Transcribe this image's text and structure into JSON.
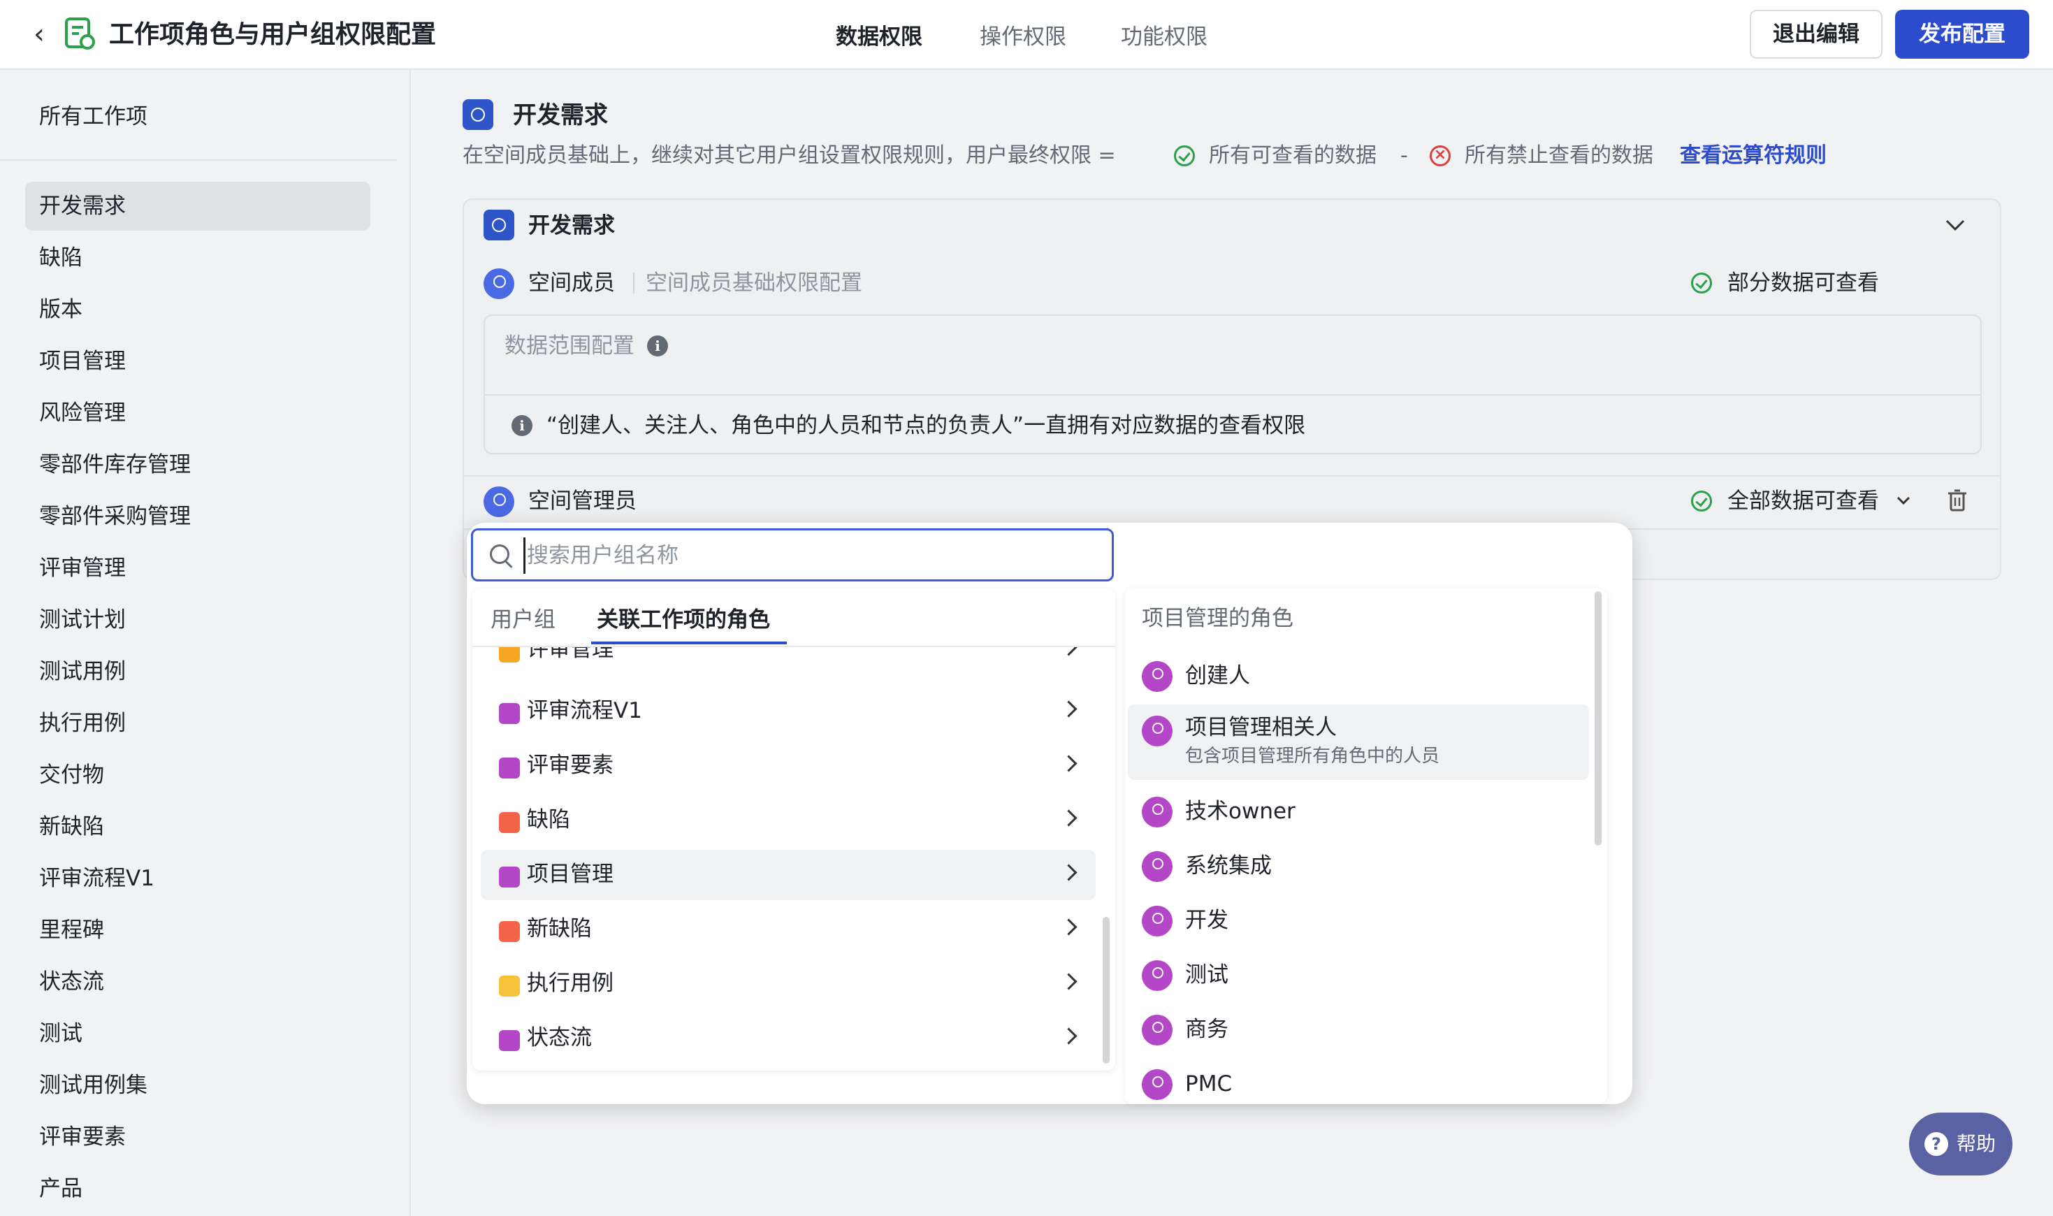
{
  "header": {
    "back_glyph": "‹",
    "title": "工作项角色与用户组权限配置",
    "tabs": [
      {
        "label": "数据权限",
        "active": true
      },
      {
        "label": "操作权限",
        "active": false
      },
      {
        "label": "功能权限",
        "active": false
      }
    ],
    "exit_label": "退出编辑",
    "publish_label": "发布配置"
  },
  "sidebar": {
    "all_label": "所有工作项",
    "items": [
      "开发需求",
      "缺陷",
      "版本",
      "项目管理",
      "风险管理",
      "零部件库存管理",
      "零部件采购管理",
      "评审管理",
      "测试计划",
      "测试用例",
      "执行用例",
      "交付物",
      "新缺陷",
      "评审流程V1",
      "里程碑",
      "状态流",
      "测试",
      "测试用例集",
      "评审要素",
      "产品"
    ],
    "active_index": 0
  },
  "main": {
    "section_title": "开发需求",
    "desc_prefix": "在空间成员基础上，继续对其它用户组设置权限规则，用户最终权限 =",
    "desc_allowed": "所有可查看的数据",
    "desc_minus": "-",
    "desc_forbidden": "所有禁止查看的数据",
    "desc_link": "查看运算符规则",
    "card": {
      "title": "开发需求",
      "member": {
        "name": "空间成员",
        "subtitle": "空间成员基础权限配置",
        "status": "部分数据可查看"
      },
      "scope_label": "数据范围配置",
      "note": "“创建人、关注人、角色中的人员和节点的负责人”一直拥有对应数据的查看权限",
      "admin": {
        "name": "空间管理员",
        "status": "全部数据可查看"
      }
    }
  },
  "popup": {
    "search_placeholder": "搜索用户组名称",
    "tabs": [
      {
        "label": "用户组",
        "active": false
      },
      {
        "label": "关联工作项的角色",
        "active": true
      }
    ],
    "list": [
      {
        "label": "评审管理",
        "color": "#f5a623"
      },
      {
        "label": "评审流程V1",
        "color": "#b347c7"
      },
      {
        "label": "评审要素",
        "color": "#b347c7"
      },
      {
        "label": "缺陷",
        "color": "#f5634a"
      },
      {
        "label": "项目管理",
        "color": "#b347c7",
        "highlight": true
      },
      {
        "label": "新缺陷",
        "color": "#f5634a"
      },
      {
        "label": "执行用例",
        "color": "#f5c23a"
      },
      {
        "label": "状态流",
        "color": "#b347c7"
      }
    ],
    "roles_title": "项目管理的角色",
    "roles": [
      {
        "label": "创建人"
      },
      {
        "label": "项目管理相关人",
        "sub": "包含项目管理所有角色中的人员",
        "highlight": true
      },
      {
        "label": "技术owner"
      },
      {
        "label": "系统集成"
      },
      {
        "label": "开发"
      },
      {
        "label": "测试"
      },
      {
        "label": "商务"
      },
      {
        "label": "PMC"
      }
    ]
  },
  "help": {
    "label": "帮助",
    "glyph": "?"
  },
  "icons": {
    "section": "check-circle-icon",
    "allowed": "check-circle-icon",
    "forbidden": "x-circle-icon",
    "info": "info-icon",
    "delete": "trash-icon",
    "expand": "chevron-down-icon",
    "search": "search-icon"
  }
}
